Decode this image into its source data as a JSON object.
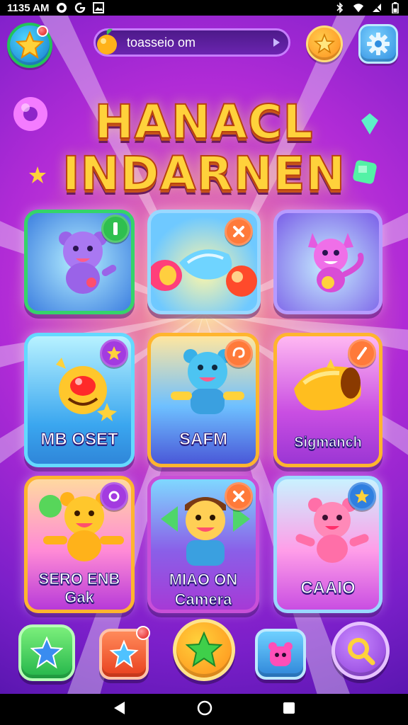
{
  "status_bar": {
    "time": "1135 AM",
    "icons_left": [
      "camera-icon",
      "g-icon",
      "image-icon"
    ],
    "icons_right": [
      "bluetooth-icon",
      "wifi-icon",
      "mute-icon",
      "battery-icon"
    ]
  },
  "top_bar": {
    "search_text": "toasseio om",
    "avatar_icon": "star-icon",
    "coin_icon": "star-coin-icon",
    "settings_icon": "gear-icon"
  },
  "title": {
    "line1": "HANACL",
    "line2": "INDARNEN"
  },
  "cards": [
    {
      "label": "",
      "character": "purple-bear",
      "badge_icon": "i-icon"
    },
    {
      "label": "",
      "character": "candy-gems",
      "badge_icon": "cross-icon"
    },
    {
      "label": "",
      "character": "pink-dragon",
      "badge_icon": ""
    },
    {
      "label": "MB OSET",
      "character": "red-ball",
      "badge_icon": "star-icon"
    },
    {
      "label": "SAFM",
      "character": "blue-bear",
      "badge_icon": "swirl-icon"
    },
    {
      "label": "Sigmanch",
      "character": "gold-horn",
      "badge_icon": "slash-icon"
    },
    {
      "label": "SERO ENB Gak",
      "character": "yellow-bear",
      "badge_icon": "o-icon"
    },
    {
      "label": "MIAO ON Camera",
      "character": "smiling-kid",
      "badge_icon": "cross-icon"
    },
    {
      "label": "CAAIO",
      "character": "pink-bear",
      "badge_icon": "star-icon"
    }
  ],
  "bottom_bar": [
    {
      "icon": "star-icon"
    },
    {
      "icon": "star-notification-icon"
    },
    {
      "icon": "big-star-icon"
    },
    {
      "icon": "monster-icon"
    },
    {
      "icon": "search-icon"
    }
  ],
  "colors": {
    "bg_purple": "#b02bd6",
    "title_gold": "#ffd23b",
    "card_green": "#35d46a",
    "card_blue": "#38b6f5",
    "card_orange": "#ff9f1c",
    "card_pink": "#e36bd8"
  }
}
